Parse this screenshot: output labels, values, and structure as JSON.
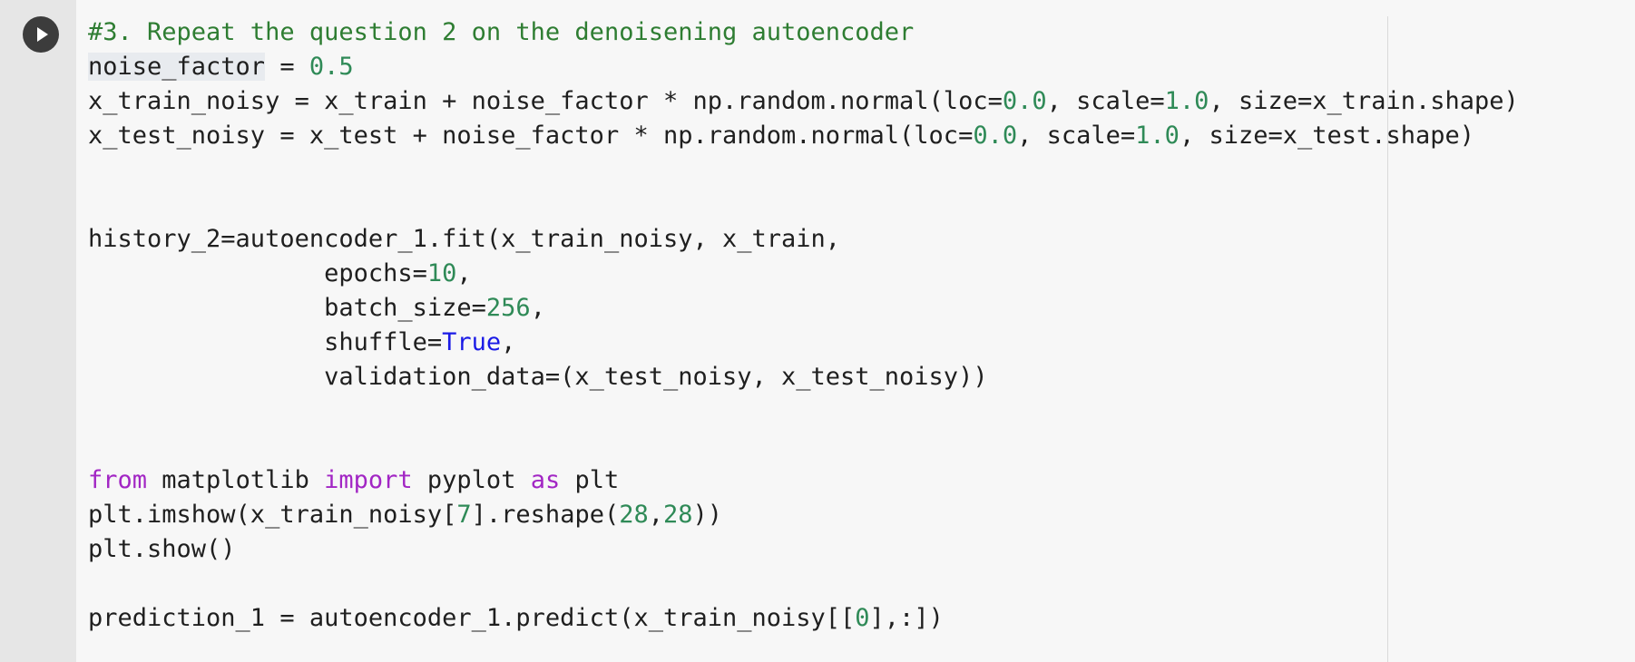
{
  "cell": {
    "run_button_icon": "play-icon",
    "lines": [
      [
        {
          "t": "#3. Repeat the question 2 on the denoisening autoencoder",
          "c": "comment"
        }
      ],
      [
        {
          "t": "noise_factor",
          "c": "plain",
          "hl": true
        },
        {
          "t": " = ",
          "c": "plain"
        },
        {
          "t": "0.5",
          "c": "num"
        }
      ],
      [
        {
          "t": "x_train_noisy = x_train + noise_factor * np.random.normal(loc=",
          "c": "plain"
        },
        {
          "t": "0.0",
          "c": "num"
        },
        {
          "t": ", scale=",
          "c": "plain"
        },
        {
          "t": "1.0",
          "c": "num"
        },
        {
          "t": ", size=x_train.shape)",
          "c": "plain"
        }
      ],
      [
        {
          "t": "x_test_noisy = x_test + noise_factor * np.random.normal(loc=",
          "c": "plain"
        },
        {
          "t": "0.0",
          "c": "num"
        },
        {
          "t": ", scale=",
          "c": "plain"
        },
        {
          "t": "1.0",
          "c": "num"
        },
        {
          "t": ", size=x_test.shape)",
          "c": "plain"
        }
      ],
      [],
      [],
      [
        {
          "t": "history_2=autoencoder_1.fit(x_train_noisy, x_train,",
          "c": "plain"
        }
      ],
      [
        {
          "t": "                epochs=",
          "c": "plain"
        },
        {
          "t": "10",
          "c": "num"
        },
        {
          "t": ",",
          "c": "plain"
        }
      ],
      [
        {
          "t": "                batch_size=",
          "c": "plain"
        },
        {
          "t": "256",
          "c": "num"
        },
        {
          "t": ",",
          "c": "plain"
        }
      ],
      [
        {
          "t": "                shuffle=",
          "c": "plain"
        },
        {
          "t": "True",
          "c": "const"
        },
        {
          "t": ",",
          "c": "plain"
        }
      ],
      [
        {
          "t": "                validation_data=(x_test_noisy, x_test_noisy))",
          "c": "plain"
        }
      ],
      [],
      [],
      [
        {
          "t": "from",
          "c": "kw"
        },
        {
          "t": " matplotlib ",
          "c": "plain"
        },
        {
          "t": "import",
          "c": "kw"
        },
        {
          "t": " pyplot ",
          "c": "plain"
        },
        {
          "t": "as",
          "c": "kw"
        },
        {
          "t": " plt",
          "c": "plain"
        }
      ],
      [
        {
          "t": "plt.imshow(x_train_noisy[",
          "c": "plain"
        },
        {
          "t": "7",
          "c": "num"
        },
        {
          "t": "].reshape(",
          "c": "plain"
        },
        {
          "t": "28",
          "c": "num"
        },
        {
          "t": ",",
          "c": "plain"
        },
        {
          "t": "28",
          "c": "num"
        },
        {
          "t": "))",
          "c": "plain"
        }
      ],
      [
        {
          "t": "plt.show()",
          "c": "plain"
        }
      ],
      [],
      [
        {
          "t": "prediction_1 = autoencoder_1.predict(x_train_noisy[[",
          "c": "plain"
        },
        {
          "t": "0",
          "c": "num"
        },
        {
          "t": "],:])",
          "c": "plain"
        }
      ]
    ]
  }
}
